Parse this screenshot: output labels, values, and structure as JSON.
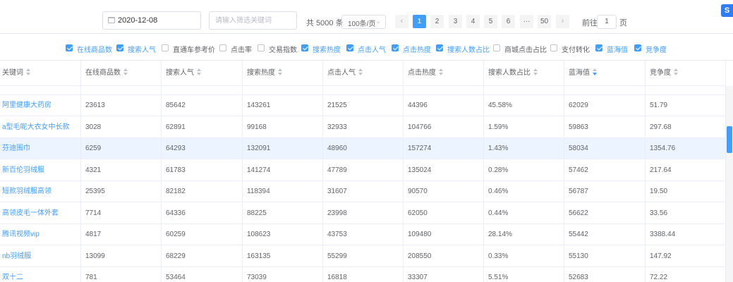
{
  "toolbar": {
    "date": "2020-12-08",
    "keyword_placeholder": "请输入筛选关键词",
    "total": "共 5000 条",
    "page_size": "100条/页",
    "pages": [
      "1",
      "2",
      "3",
      "4",
      "5",
      "6",
      "···",
      "50"
    ],
    "prev_icon": "‹",
    "next_icon": "›",
    "goto_label": "前往",
    "goto_value": "1",
    "goto_suffix": "页",
    "extension_badge": "S"
  },
  "filters": [
    {
      "label": "在线商品数",
      "checked": true
    },
    {
      "label": "搜索人气",
      "checked": true
    },
    {
      "label": "直通车参考价",
      "checked": false
    },
    {
      "label": "点击率",
      "checked": false
    },
    {
      "label": "交易指数",
      "checked": false
    },
    {
      "label": "搜索热度",
      "checked": true
    },
    {
      "label": "点击人气",
      "checked": true
    },
    {
      "label": "点击热度",
      "checked": true
    },
    {
      "label": "搜索人数占比",
      "checked": true
    },
    {
      "label": "商城点击占比",
      "checked": false
    },
    {
      "label": "支付转化",
      "checked": false
    },
    {
      "label": "蓝海值",
      "checked": true
    },
    {
      "label": "竞争度",
      "checked": true
    }
  ],
  "table": {
    "columns": [
      "关键词",
      "在线商品数",
      "搜索人气",
      "搜索热度",
      "点击人气",
      "点击热度",
      "搜索人数占比",
      "蓝海值",
      "竞争度"
    ],
    "rows": [
      [
        "阿里健康大药房",
        "23613",
        "85642",
        "143261",
        "21525",
        "44396",
        "45.58%",
        "62029",
        "51.79"
      ],
      [
        "a型毛呢大衣女中长款",
        "3028",
        "62891",
        "99168",
        "32933",
        "104766",
        "1.59%",
        "59863",
        "297.68"
      ],
      [
        "芬迪围巾",
        "6259",
        "64293",
        "132091",
        "48960",
        "157274",
        "1.43%",
        "58034",
        "1354.76"
      ],
      [
        "新百伦羽绒服",
        "4321",
        "61783",
        "141274",
        "47789",
        "135024",
        "0.28%",
        "57462",
        "217.64"
      ],
      [
        "短款羽绒服高领",
        "25395",
        "82182",
        "118394",
        "31607",
        "90570",
        "0.46%",
        "56787",
        "19.50"
      ],
      [
        "高领皮毛一体外套",
        "7714",
        "64336",
        "88225",
        "23998",
        "62050",
        "0.44%",
        "56622",
        "33.56"
      ],
      [
        "腾讯视频vip",
        "4817",
        "60259",
        "108623",
        "43753",
        "109480",
        "28.14%",
        "55442",
        "3388.44"
      ],
      [
        "nb羽绒服",
        "13099",
        "68229",
        "163135",
        "55299",
        "208550",
        "0.33%",
        "55130",
        "147.92"
      ],
      [
        "双十二",
        "781",
        "53464",
        "73039",
        "16818",
        "33307",
        "5.51%",
        "52683",
        "72.22"
      ]
    ]
  },
  "colors": {
    "accent": "#409eff",
    "row_highlight": "#ecf5ff",
    "text": "#606266",
    "border": "#ebeef5"
  }
}
